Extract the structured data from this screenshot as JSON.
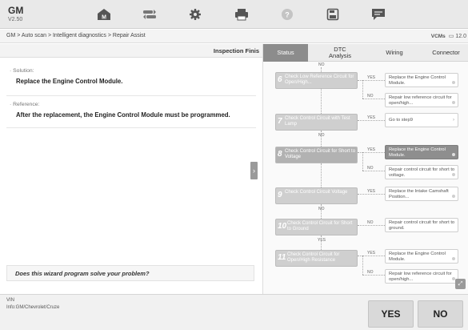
{
  "app": {
    "name": "GM",
    "version": "V2.50"
  },
  "toolbar": {
    "icons": [
      "home-icon",
      "vehicle-swap-icon",
      "settings-icon",
      "print-icon",
      "help-icon",
      "save-icon",
      "message-icon"
    ]
  },
  "breadcrumb": {
    "path": "GM > Auto scan > Intelligent diagnostics > Repair Assist",
    "right_brand": "VCMs",
    "right_value": "12.0"
  },
  "left": {
    "header_title": "Inspection Finis",
    "solution_label": "· Solution:",
    "solution_text": "Replace the Engine Control Module.",
    "reference_label": "· Reference:",
    "reference_text": "After the replacement, the Engine Control Module must be programmed.",
    "question": "Does this wizard program solve your problem?"
  },
  "tabs": [
    {
      "label": "Status",
      "active": true
    },
    {
      "label": "DTC Analysis",
      "active": false
    },
    {
      "label": "Wiring",
      "active": false
    },
    {
      "label": "Connector",
      "active": false
    }
  ],
  "flow": {
    "top_no": "NO",
    "steps": [
      {
        "num": "6",
        "text": "Check Low Reference Circuit for Open/High...",
        "yes": "YES",
        "yes_result": "Replace the Engine Control Module.",
        "no": "NO",
        "no_result": "Repair low reference circuit for open/high..."
      },
      {
        "num": "7",
        "text": "Check Control Circuit with Test Lamp",
        "yes": "YES",
        "yes_result": "Go to step9",
        "no": "NO"
      },
      {
        "num": "8",
        "text": "Check Control Circuit for Short to Voltage",
        "yes": "YES",
        "yes_result": "Replace the Engine Control Module.",
        "no": "NO",
        "no_result": "Repair control circuit for short to voltage."
      },
      {
        "num": "9",
        "text": "Check Control Circuit Voltage",
        "yes": "YES",
        "yes_result": "Replace the Intake Camshaft Position...",
        "no": "NO"
      },
      {
        "num": "10",
        "text": "Check Control Circuit for Short to Ground",
        "no": "NO",
        "no_result": "Repair control circuit for short to ground.",
        "yes": "YES"
      },
      {
        "num": "11",
        "text": "Check Control Circuit for Open/High Resistance",
        "yes": "YES",
        "yes_result": "Replace the Engine Control Module.",
        "no": "NO",
        "no_result": "Repair low reference circuit for open/high..."
      }
    ]
  },
  "bottom": {
    "vin_label": "VIN",
    "vehicle_info": "Info:GM/Chevrolet/Cruze",
    "yes_button": "YES",
    "no_button": "NO"
  },
  "colors": {
    "toolbar_bg": "#e9e9e9",
    "active_tab": "#8c8c8c",
    "step_node": "#cfcfcf",
    "highlight_result": "#8e8e8e"
  }
}
